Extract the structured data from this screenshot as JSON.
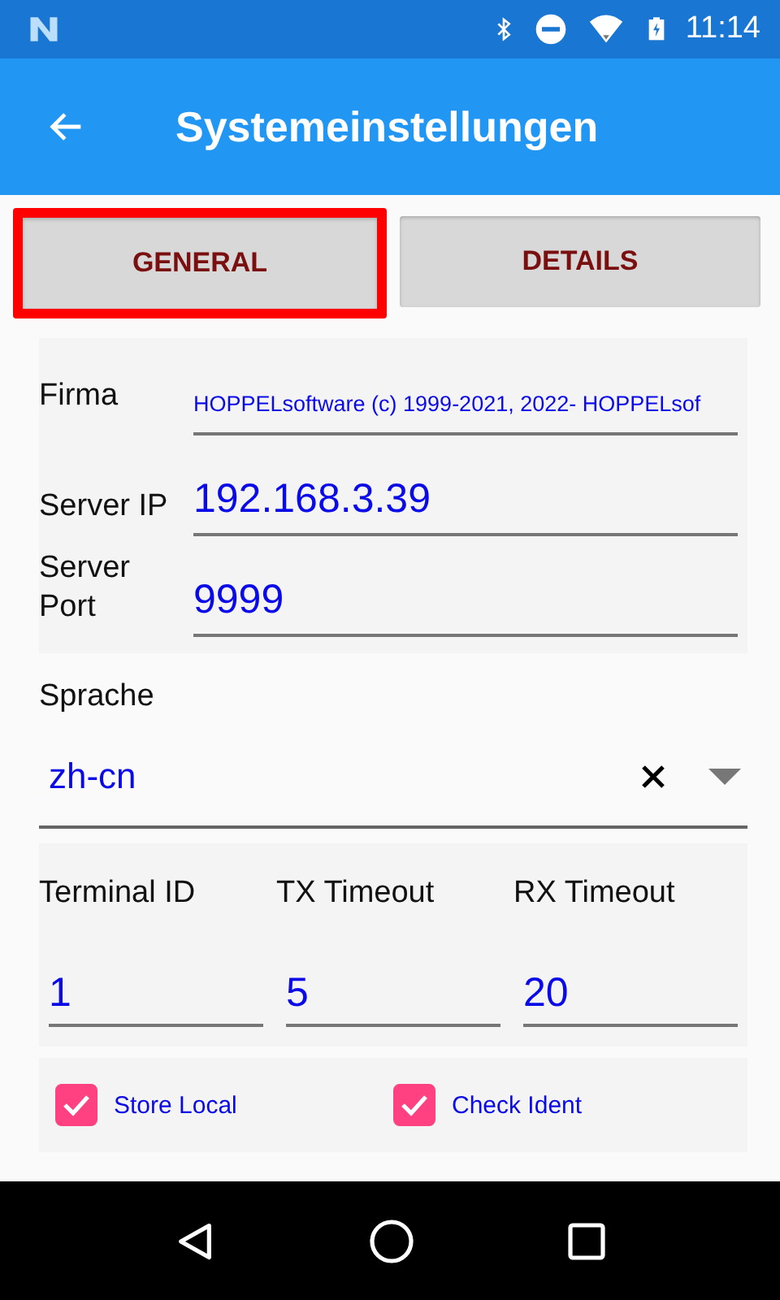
{
  "status_bar": {
    "time": "11:14"
  },
  "app_bar": {
    "title": "Systemeinstellungen"
  },
  "tabs": [
    {
      "label": "GENERAL",
      "selected": true
    },
    {
      "label": "DETAILS",
      "selected": false
    }
  ],
  "server_fields": [
    {
      "label": "Firma",
      "value": "HOPPELsoftware (c) 1999-2021, 2022- HOPPELsof",
      "kind": "small"
    },
    {
      "label": "Server IP",
      "value": "192.168.3.39",
      "kind": "large"
    },
    {
      "label": "Server Port",
      "value": "9999",
      "kind": "large"
    }
  ],
  "language": {
    "label": "Sprache",
    "value": "zh-cn"
  },
  "timeouts": [
    {
      "label": "Terminal ID",
      "value": "1"
    },
    {
      "label": "TX Timeout",
      "value": "5"
    },
    {
      "label": "RX Timeout",
      "value": "20"
    }
  ],
  "checkboxes": [
    {
      "label": "Store Local",
      "checked": true
    },
    {
      "label": "Check Ident",
      "checked": true
    }
  ]
}
